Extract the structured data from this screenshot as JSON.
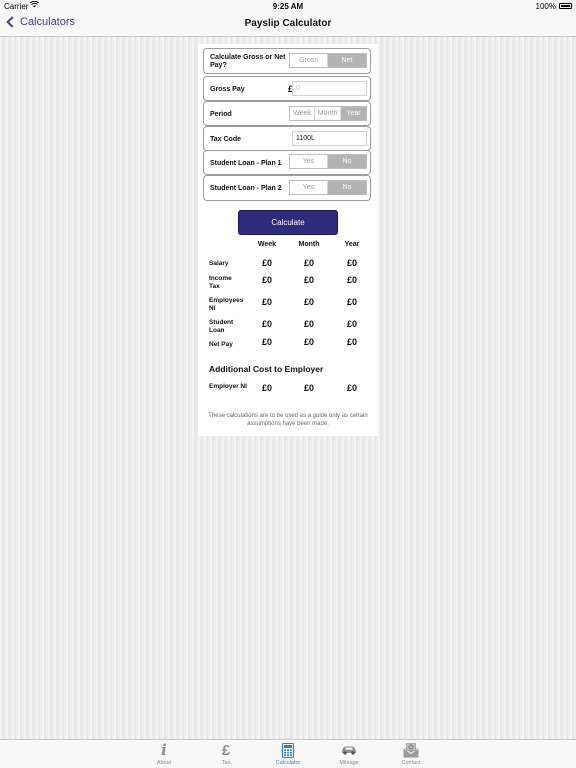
{
  "status_bar": {
    "carrier": "Carrier",
    "time": "9:25 AM",
    "battery": "100%"
  },
  "nav": {
    "back_label": "Calculators",
    "title": "Payslip Calculator"
  },
  "form": {
    "gross_or_net": {
      "label": "Calculate Gross or Net Pay?",
      "options": [
        "Gross",
        "Net"
      ],
      "selected": "Net"
    },
    "gross_pay": {
      "label": "Gross Pay",
      "currency": "£",
      "placeholder": "0"
    },
    "period": {
      "label": "Period",
      "options": [
        "Week",
        "Month",
        "Year"
      ],
      "selected": "Year"
    },
    "tax_code": {
      "label": "Tax Code",
      "value": "1100L"
    },
    "student_loan_1": {
      "label": "Student Loan - Plan 1",
      "options": [
        "Yes",
        "No"
      ],
      "selected": "No"
    },
    "student_loan_2": {
      "label": "Student Loan - Plan 2",
      "options": [
        "Yes",
        "No"
      ],
      "selected": "No"
    },
    "calculate_label": "Calculate"
  },
  "results": {
    "columns": [
      "Week",
      "Month",
      "Year"
    ],
    "rows": [
      {
        "label": "Salary",
        "values": [
          "£0",
          "£0",
          "£0"
        ]
      },
      {
        "label": "Income Tax",
        "values": [
          "£0",
          "£0",
          "£0"
        ]
      },
      {
        "label": "Employees NI",
        "values": [
          "£0",
          "£0",
          "£0"
        ]
      },
      {
        "label": "Student Loan",
        "values": [
          "£0",
          "£0",
          "£0"
        ]
      },
      {
        "label": "Net Pay",
        "values": [
          "£0",
          "£0",
          "£0"
        ]
      }
    ],
    "additional_title": "Additional Cost to Employer",
    "employer_row": {
      "label": "Employer NI",
      "values": [
        "£0",
        "£0",
        "£0"
      ]
    },
    "disclaimer": "These calculations are to be used as a guide only as certain assumptions have been made."
  },
  "tabs": [
    {
      "label": "About",
      "icon": "info-icon",
      "glyph": "i"
    },
    {
      "label": "Tax",
      "icon": "pound-icon",
      "glyph": "£"
    },
    {
      "label": "Calculator",
      "icon": "calculator-icon",
      "glyph": ""
    },
    {
      "label": "Mileage",
      "icon": "car-icon",
      "glyph": ""
    },
    {
      "label": "Contact",
      "icon": "mail-icon",
      "glyph": ""
    }
  ],
  "active_tab": "Calculator",
  "colors": {
    "accent": "#4b3a8c",
    "button": "#2f2b7c",
    "tab_active": "#2f7fcf"
  }
}
